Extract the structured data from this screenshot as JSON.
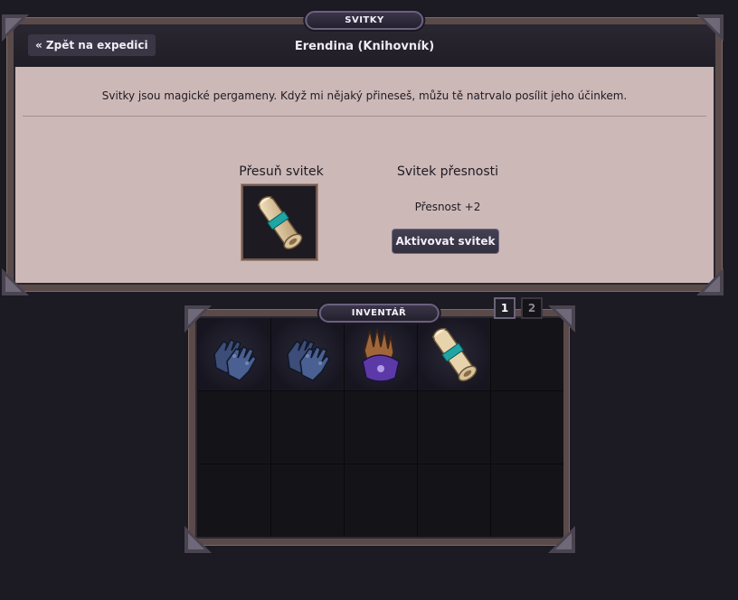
{
  "svitky_panel": {
    "title": "SVITKY",
    "back_label": "« Zpět na expedici",
    "npc_name": "Erendina (Knihovník)",
    "intro": "Svitky jsou magické pergameny. Když mi nějaký přineseš, můžu tě natrvalo posílit jeho účinkem.",
    "move_label": "Přesuň svitek",
    "scroll_name": "Svitek přesnosti",
    "scroll_effect": "Přesnost +2",
    "activate_label": "Aktivovat svitek",
    "slot_item_icon": "scroll-icon"
  },
  "inventory": {
    "title": "INVENTÁŘ",
    "pages": [
      "1",
      "2"
    ],
    "active_page": "1",
    "slots": [
      {
        "item": "gauntlets-icon"
      },
      {
        "item": "gauntlets-icon"
      },
      {
        "item": "purple-gloves-icon"
      },
      {
        "item": "scroll-icon"
      },
      {
        "item": null
      },
      {
        "item": null
      },
      {
        "item": null
      },
      {
        "item": null
      },
      {
        "item": null
      },
      {
        "item": null
      },
      {
        "item": null
      },
      {
        "item": null
      },
      {
        "item": null
      },
      {
        "item": null
      },
      {
        "item": null
      }
    ]
  },
  "colors": {
    "panel_bg": "#cdb8b8",
    "header_bg": "#201d26",
    "frame": "#5a4a4a",
    "page_bg": "#1c1a23"
  }
}
